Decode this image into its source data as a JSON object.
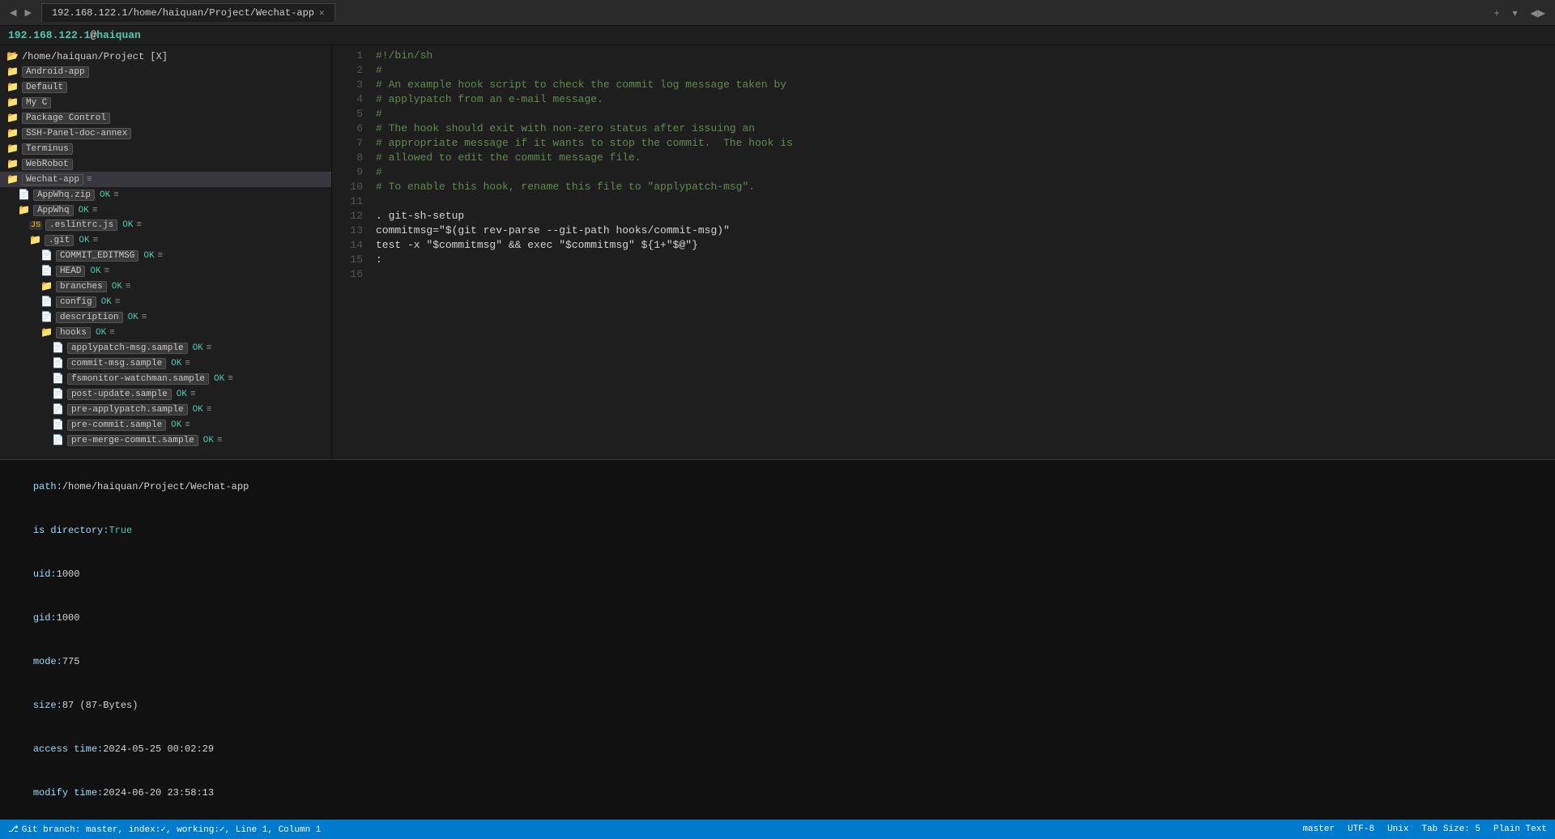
{
  "topbar": {
    "nav_back": "◀",
    "nav_fwd": "▶",
    "tab_label": "192.168.122.1/home/haiquan/Project/Wechat-app",
    "tab_close": "✕",
    "add_btn": "+",
    "chevron_btn": "▾",
    "left_right_btn": "◀▶",
    "expand_btn": "⬜"
  },
  "ssh_host": {
    "ip": "192.168.122.1",
    "at": "@",
    "user": "haiquan"
  },
  "sidebar": {
    "folder_header": "/home/haiquan/Project  [X]",
    "items": [
      {
        "indent": 0,
        "type": "folder",
        "name": "Android-app",
        "ok": null,
        "menu": null
      },
      {
        "indent": 0,
        "type": "folder",
        "name": "Default",
        "ok": null,
        "menu": null
      },
      {
        "indent": 0,
        "type": "folder",
        "name": "My C",
        "ok": null,
        "menu": null
      },
      {
        "indent": 0,
        "type": "folder",
        "name": "Package Control",
        "ok": null,
        "menu": null
      },
      {
        "indent": 0,
        "type": "folder",
        "name": "SSH-Panel-doc-annex",
        "ok": null,
        "menu": null
      },
      {
        "indent": 0,
        "type": "folder",
        "name": "Terminus",
        "ok": null,
        "menu": null
      },
      {
        "indent": 0,
        "type": "folder",
        "name": "WebRobot",
        "ok": null,
        "menu": null
      },
      {
        "indent": 0,
        "type": "folder",
        "name": "Wechat-app",
        "ok": null,
        "menu": "≡",
        "selected": true
      },
      {
        "indent": 1,
        "type": "file-zip",
        "name": "AppWhq.zip",
        "ok": "OK",
        "menu": "≡"
      },
      {
        "indent": 1,
        "type": "folder",
        "name": "AppWhq",
        "ok": "OK",
        "menu": "≡"
      },
      {
        "indent": 2,
        "type": "js-file",
        "name": ".eslintrc.js",
        "ok": "OK",
        "menu": "≡"
      },
      {
        "indent": 2,
        "type": "git-folder",
        "name": ".git",
        "ok": "OK",
        "menu": "≡"
      },
      {
        "indent": 3,
        "type": "file",
        "name": "COMMIT_EDITMSG",
        "ok": "OK",
        "menu": "≡"
      },
      {
        "indent": 3,
        "type": "file",
        "name": "HEAD",
        "ok": "OK",
        "menu": "≡"
      },
      {
        "indent": 3,
        "type": "folder",
        "name": "branches",
        "ok": "OK",
        "menu": "≡",
        "detected": true
      },
      {
        "indent": 3,
        "type": "file",
        "name": "config",
        "ok": "OK",
        "menu": "≡"
      },
      {
        "indent": 3,
        "type": "file",
        "name": "description",
        "ok": "OK",
        "menu": "≡"
      },
      {
        "indent": 3,
        "type": "folder",
        "name": "hooks",
        "ok": "OK",
        "menu": "≡"
      },
      {
        "indent": 4,
        "type": "file",
        "name": "applypatch-msg.sample",
        "ok": "OK",
        "menu": "≡"
      },
      {
        "indent": 4,
        "type": "file",
        "name": "commit-msg.sample",
        "ok": "OK",
        "menu": "≡"
      },
      {
        "indent": 4,
        "type": "file",
        "name": "fsmonitor-watchman.sample",
        "ok": "OK",
        "menu": "≡"
      },
      {
        "indent": 4,
        "type": "file",
        "name": "post-update.sample",
        "ok": "OK",
        "menu": "≡"
      },
      {
        "indent": 4,
        "type": "file",
        "name": "pre-applypatch.sample",
        "ok": "OK",
        "menu": "≡"
      },
      {
        "indent": 4,
        "type": "file",
        "name": "pre-commit.sample",
        "ok": "OK",
        "menu": "≡"
      },
      {
        "indent": 4,
        "type": "file",
        "name": "pre-merge-commit.sample",
        "ok": "OK",
        "menu": "≡"
      }
    ]
  },
  "editor": {
    "lines": [
      {
        "num": 1,
        "content": "#!/bin/sh",
        "type": "shebang"
      },
      {
        "num": 2,
        "content": "#",
        "type": "comment"
      },
      {
        "num": 3,
        "content": "# An example hook script to check the commit log message taken by",
        "type": "comment"
      },
      {
        "num": 4,
        "content": "# applypatch from an e-mail message.",
        "type": "comment"
      },
      {
        "num": 5,
        "content": "#",
        "type": "comment"
      },
      {
        "num": 6,
        "content": "# The hook should exit with non-zero status after issuing an",
        "type": "comment"
      },
      {
        "num": 7,
        "content": "# appropriate message if it wants to stop the commit.  The hook is",
        "type": "comment"
      },
      {
        "num": 8,
        "content": "# allowed to edit the commit message file.",
        "type": "comment"
      },
      {
        "num": 9,
        "content": "#",
        "type": "comment"
      },
      {
        "num": 10,
        "content": "# To enable this hook, rename this file to \"applypatch-msg\".",
        "type": "comment"
      },
      {
        "num": 11,
        "content": "",
        "type": "empty"
      },
      {
        "num": 12,
        "content": ". git-sh-setup",
        "type": "code"
      },
      {
        "num": 13,
        "content": "commitmsg=\"$(git rev-parse --git-path hooks/commit-msg)\"",
        "type": "code"
      },
      {
        "num": 14,
        "content": "test -x \"$commitmsg\" && exec \"$commitmsg\" ${1+\"$@\"}",
        "type": "code"
      },
      {
        "num": 15,
        "content": ":",
        "type": "code"
      },
      {
        "num": 16,
        "content": "",
        "type": "empty"
      }
    ]
  },
  "bottom_panel": {
    "path_label": "path:",
    "path_value": "/home/haiquan/Project/Wechat-app",
    "is_directory_label": "is directory:",
    "is_directory_value": "True",
    "uid_label": "uid:",
    "uid_value": "1000",
    "gid_label": "gid:",
    "gid_value": "1000",
    "mode_label": "mode:",
    "mode_value": "775",
    "size_label": "size:",
    "size_value": "87 (87-Bytes)",
    "access_time_label": "access time:",
    "access_time_value": "2024-05-25 00:02:29",
    "modify_time_label": "modify time:",
    "modify_time_value": "2024-06-20 23:58:13"
  },
  "status_bar": {
    "git_branch_label": "Git branch: master, index:✓, working:✓, Line 1, Column 1",
    "encoding": "UTF-8",
    "line_ending": "Unix",
    "tab_size": "Tab Size: 5",
    "syntax": "Plain Text",
    "branch": "master"
  }
}
